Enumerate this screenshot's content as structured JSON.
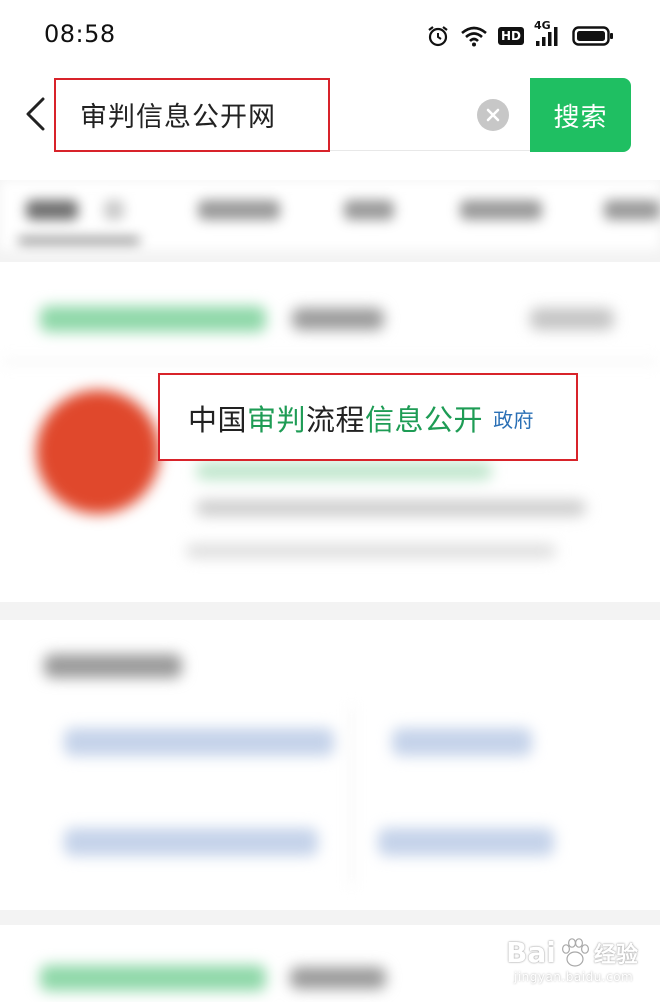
{
  "status_bar": {
    "time": "08:58",
    "hd_label": "HD",
    "network_label": "4G"
  },
  "search": {
    "query": "审判信息公开网",
    "button_label": "搜索"
  },
  "result": {
    "title_parts": [
      "中国",
      "审判",
      "流程",
      "信息公开"
    ],
    "badge": "政府"
  },
  "watermark": {
    "brand": "Bai",
    "brand_tail": "经验",
    "url": "jingyan.baidu.com"
  },
  "colors": {
    "accent_green": "#1fbf62",
    "highlight_green": "#1e9c55",
    "annotation_red": "#d8232a",
    "badge_blue": "#2a6fb5"
  }
}
